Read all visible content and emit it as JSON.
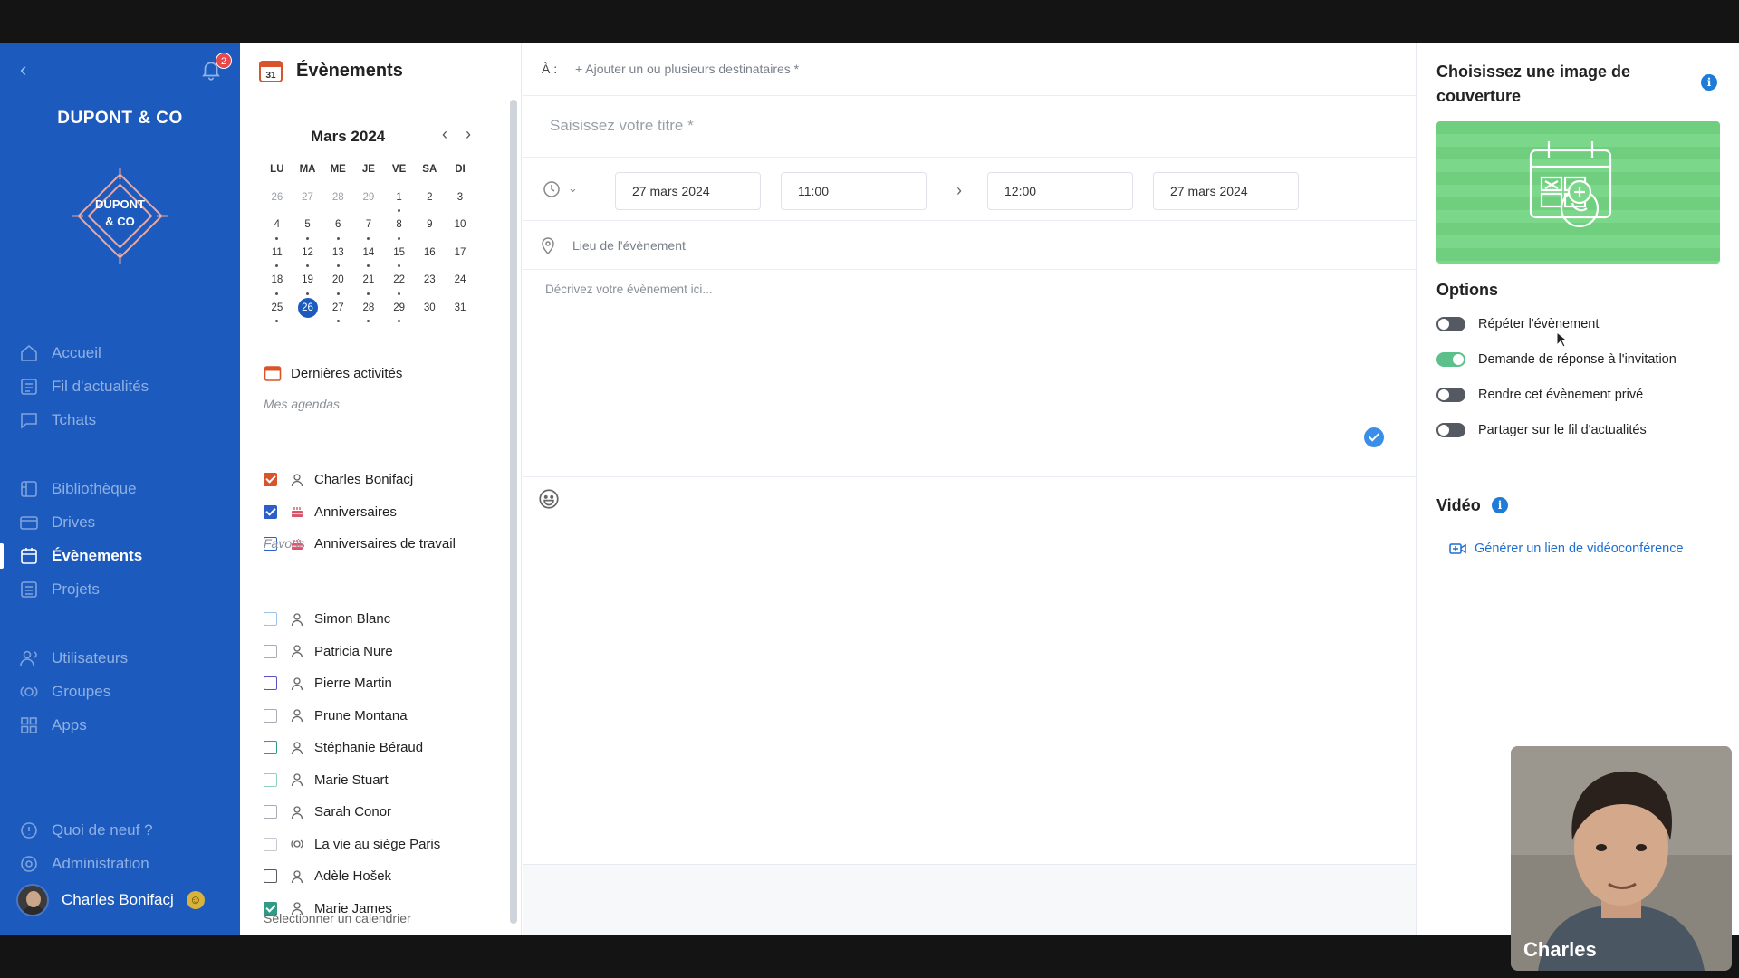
{
  "sidebar": {
    "company": "DUPONT & CO",
    "logo_text": [
      "DUPONT",
      "& CO"
    ],
    "notifications": "2",
    "nav": [
      {
        "label": "Accueil",
        "icon": "home-icon",
        "active": false
      },
      {
        "label": "Fil d'actualités",
        "icon": "newsfeed-icon",
        "active": false
      },
      {
        "label": "Tchats",
        "icon": "chat-icon",
        "active": false
      },
      {
        "label": "Bibliothèque",
        "icon": "library-icon",
        "active": false
      },
      {
        "label": "Drives",
        "icon": "drive-icon",
        "active": false
      },
      {
        "label": "Évènements",
        "icon": "calendar-icon",
        "active": true
      },
      {
        "label": "Projets",
        "icon": "projects-icon",
        "active": false
      },
      {
        "label": "Utilisateurs",
        "icon": "users-icon",
        "active": false
      },
      {
        "label": "Groupes",
        "icon": "groups-icon",
        "active": false
      },
      {
        "label": "Apps",
        "icon": "apps-icon",
        "active": false
      },
      {
        "label": "Quoi de neuf ?",
        "icon": "whats-new-icon",
        "active": false
      },
      {
        "label": "Administration",
        "icon": "admin-icon",
        "active": false
      }
    ],
    "user": {
      "name": "Charles Bonifacj",
      "emoji": "☺"
    }
  },
  "calendar": {
    "title": "Évènements",
    "calendar_icon_day": "31",
    "month": "Mars 2024",
    "weekdays": [
      "LU",
      "MA",
      "ME",
      "JE",
      "VE",
      "SA",
      "DI"
    ],
    "weeks": [
      [
        [
          "26",
          "muted"
        ],
        [
          "27",
          "muted"
        ],
        [
          "28",
          "muted"
        ],
        [
          "29",
          "muted"
        ],
        [
          "1",
          "dot"
        ],
        [
          "2",
          ""
        ],
        [
          "3",
          ""
        ]
      ],
      [
        [
          "4",
          "dot"
        ],
        [
          "5",
          "dot"
        ],
        [
          "6",
          "dot"
        ],
        [
          "7",
          "dot"
        ],
        [
          "8",
          "dot"
        ],
        [
          "9",
          ""
        ],
        [
          "10",
          ""
        ]
      ],
      [
        [
          "11",
          "dot"
        ],
        [
          "12",
          "dot"
        ],
        [
          "13",
          "dot"
        ],
        [
          "14",
          "dot"
        ],
        [
          "15",
          "dot"
        ],
        [
          "16",
          ""
        ],
        [
          "17",
          ""
        ]
      ],
      [
        [
          "18",
          "dot"
        ],
        [
          "19",
          "dot"
        ],
        [
          "20",
          "dot"
        ],
        [
          "21",
          "dot"
        ],
        [
          "22",
          "dot"
        ],
        [
          "23",
          ""
        ],
        [
          "24",
          ""
        ]
      ],
      [
        [
          "25",
          "dot"
        ],
        [
          "26",
          "today"
        ],
        [
          "27",
          "dot"
        ],
        [
          "28",
          "dot"
        ],
        [
          "29",
          "dot"
        ],
        [
          "30",
          ""
        ],
        [
          "31",
          ""
        ]
      ]
    ],
    "recent_activity": "Dernières activités",
    "my_agendas_label": "Mes agendas",
    "my_agendas": [
      {
        "label": "Charles Bonifacj",
        "checked": true,
        "color": "#d9542b",
        "icon": "person-icon"
      },
      {
        "label": "Anniversaires",
        "checked": true,
        "color": "#2d5fc9",
        "icon": "cake-icon"
      },
      {
        "label": "Anniversaires de travail",
        "checked": false,
        "color": "#2d5fc9",
        "icon": "cake-icon"
      }
    ],
    "favorites_label": "Favoris",
    "favorites": [
      {
        "label": "Simon Blanc",
        "checked": false,
        "color": "#9cc3ea",
        "icon": "person-icon"
      },
      {
        "label": "Patricia Nure",
        "checked": false,
        "color": "#a7adb6",
        "icon": "person-icon"
      },
      {
        "label": "Pierre Martin",
        "checked": false,
        "color": "#5b4fc4",
        "icon": "person-icon"
      },
      {
        "label": "Prune Montana",
        "checked": false,
        "color": "#a7adb6",
        "icon": "person-icon"
      },
      {
        "label": "Stéphanie Béraud",
        "checked": false,
        "color": "#2f9a86",
        "icon": "person-icon"
      },
      {
        "label": "Marie Stuart",
        "checked": false,
        "color": "#8fd2b8",
        "icon": "person-icon"
      },
      {
        "label": "Sarah Conor",
        "checked": false,
        "color": "#a7adb6",
        "icon": "person-icon"
      },
      {
        "label": "La vie au siège Paris",
        "checked": false,
        "color": "#c4c9d0",
        "icon": "group-icon"
      },
      {
        "label": "Adèle Hošek",
        "checked": false,
        "color": "#555a62",
        "icon": "person-icon"
      },
      {
        "label": "Marie James",
        "checked": true,
        "color": "#2f9a86",
        "icon": "person-icon"
      }
    ],
    "select_calendar": "Sélectionner un calendrier"
  },
  "form": {
    "to_label": "À :",
    "to_add": "+ Ajouter un ou plusieurs destinataires *",
    "title_placeholder": "Saisissez votre titre *",
    "start_date": "27 mars 2024",
    "start_time": "11:00",
    "end_time": "12:00",
    "end_date": "27 mars 2024",
    "place_placeholder": "Lieu de l'évènement",
    "description_placeholder": "Décrivez votre évènement ici..."
  },
  "right": {
    "cover_title": "Choisissez une image de couverture",
    "options_title": "Options",
    "options": [
      {
        "label": "Répéter l'évènement",
        "on": false
      },
      {
        "label": "Demande de réponse à l'invitation",
        "on": true
      },
      {
        "label": "Rendre cet évènement privé",
        "on": false
      },
      {
        "label": "Partager sur le fil d'actualités",
        "on": false
      }
    ],
    "video_title": "Vidéo",
    "video_link": "Générer un lien de vidéoconférence"
  },
  "webcam": {
    "name": "Charles"
  },
  "colors": {
    "sidebar": "#1c5bbd",
    "accent": "#1e6fd0",
    "toggle_on": "#5bc08a",
    "cover": "#6fcf7e"
  }
}
